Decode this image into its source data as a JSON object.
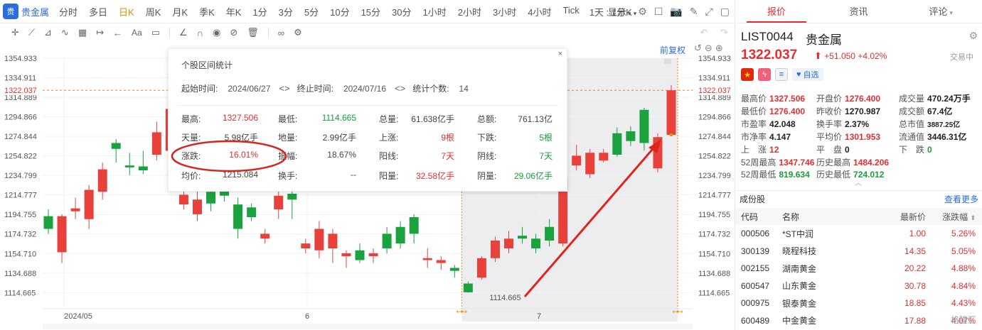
{
  "toolbar": {
    "logo_text": "贵",
    "stock_name": "贵金属",
    "periods": [
      "分时",
      "多日",
      "日K",
      "周K",
      "月K",
      "季K",
      "年K",
      "1分",
      "3分",
      "5分",
      "10分",
      "15分",
      "30分",
      "1小时",
      "2小时",
      "3小时",
      "4小时",
      "Tick"
    ],
    "active_period": "日K",
    "combo": "1天 : 1分K",
    "display_label": "显示",
    "display_chev": "▾"
  },
  "chart": {
    "fuquan_label": "前复权",
    "y_ticks": [
      "1354.933",
      "1334.911",
      "1314.889",
      "1294.866",
      "1274.844",
      "1254.822",
      "1234.799",
      "1214.777",
      "1194.755",
      "1174.732",
      "1154.710",
      "1134.688",
      "1114.665"
    ],
    "right_ticks": [
      "1354.933",
      "1334.911",
      "1314.889",
      "1294.866",
      "1274.844",
      "1254.822",
      "1234.799",
      "1214.777",
      "1194.755",
      "1174.732",
      "1154.710",
      "1134.688",
      "1114.665"
    ],
    "current_price_tag": "1322.037",
    "x_labels": [
      "2024/05",
      "6",
      "7"
    ],
    "low_label": "1114.665",
    "colors": {
      "up": "#e8413c",
      "down": "#1aa23e",
      "accent": "#f08a00",
      "selection": "#e9e9ec"
    }
  },
  "chart_data": {
    "type": "candlestick",
    "title": "",
    "ylim": [
      1104,
      1368
    ],
    "current_price": 1322.037,
    "selection_low": 1114.665,
    "x_ticks": [
      "2024/05",
      "6",
      "7"
    ],
    "candles": [
      {
        "o": 1193,
        "c": 1180,
        "h": 1200,
        "l": 1175
      },
      {
        "o": 1156,
        "c": 1193,
        "h": 1195,
        "l": 1145
      },
      {
        "o": 1198,
        "c": 1201,
        "h": 1212,
        "l": 1190
      },
      {
        "o": 1190,
        "c": 1220,
        "h": 1225,
        "l": 1180
      },
      {
        "o": 1218,
        "c": 1241,
        "h": 1248,
        "l": 1210
      },
      {
        "o": 1268,
        "c": 1262,
        "h": 1272,
        "l": 1248
      },
      {
        "o": 1245,
        "c": 1243,
        "h": 1258,
        "l": 1235
      },
      {
        "o": 1244,
        "c": 1240,
        "h": 1260,
        "l": 1236
      },
      {
        "o": 1256,
        "c": 1279,
        "h": 1290,
        "l": 1250
      },
      {
        "o": 1303,
        "c": 1260,
        "h": 1310,
        "l": 1255
      },
      {
        "o": 1215,
        "c": 1205,
        "h": 1222,
        "l": 1200
      },
      {
        "o": 1210,
        "c": 1195,
        "h": 1220,
        "l": 1188
      },
      {
        "o": 1206,
        "c": 1218,
        "h": 1228,
        "l": 1198
      },
      {
        "o": 1220,
        "c": 1214,
        "h": 1226,
        "l": 1208
      },
      {
        "o": 1205,
        "c": 1180,
        "h": 1212,
        "l": 1170
      },
      {
        "o": 1192,
        "c": 1202,
        "h": 1206,
        "l": 1188
      },
      {
        "o": 1170,
        "c": 1175,
        "h": 1180,
        "l": 1165
      },
      {
        "o": 1200,
        "c": 1214,
        "h": 1220,
        "l": 1190
      },
      {
        "o": 1210,
        "c": 1216,
        "h": 1226,
        "l": 1190
      },
      {
        "o": 1160,
        "c": 1165,
        "h": 1170,
        "l": 1155
      },
      {
        "o": 1180,
        "c": 1158,
        "h": 1188,
        "l": 1150
      },
      {
        "o": 1175,
        "c": 1160,
        "h": 1180,
        "l": 1145
      },
      {
        "o": 1152,
        "c": 1155,
        "h": 1158,
        "l": 1140
      },
      {
        "o": 1148,
        "c": 1158,
        "h": 1165,
        "l": 1145
      },
      {
        "o": 1155,
        "c": 1152,
        "h": 1160,
        "l": 1145
      },
      {
        "o": 1160,
        "c": 1175,
        "h": 1182,
        "l": 1155
      },
      {
        "o": 1165,
        "c": 1182,
        "h": 1188,
        "l": 1160
      },
      {
        "o": 1175,
        "c": 1192,
        "h": 1195,
        "l": 1165
      },
      {
        "o": 1150,
        "c": 1148,
        "h": 1160,
        "l": 1140
      },
      {
        "o": 1148,
        "c": 1145,
        "h": 1152,
        "l": 1138
      },
      {
        "o": 1140,
        "c": 1137,
        "h": 1143,
        "l": 1130
      },
      {
        "o": 1124,
        "c": 1115,
        "h": 1126,
        "l": 1114.665
      },
      {
        "o": 1130,
        "c": 1150,
        "h": 1152,
        "l": 1128
      },
      {
        "o": 1150,
        "c": 1168,
        "h": 1172,
        "l": 1146
      },
      {
        "o": 1160,
        "c": 1170,
        "h": 1178,
        "l": 1155
      },
      {
        "o": 1170,
        "c": 1173,
        "h": 1182,
        "l": 1165
      },
      {
        "o": 1160,
        "c": 1170,
        "h": 1175,
        "l": 1155
      },
      {
        "o": 1168,
        "c": 1182,
        "h": 1190,
        "l": 1162
      },
      {
        "o": 1165,
        "c": 1232,
        "h": 1235,
        "l": 1162
      },
      {
        "o": 1245,
        "c": 1255,
        "h": 1266,
        "l": 1240
      },
      {
        "o": 1236,
        "c": 1258,
        "h": 1262,
        "l": 1232
      },
      {
        "o": 1250,
        "c": 1258,
        "h": 1262,
        "l": 1248
      },
      {
        "o": 1256,
        "c": 1278,
        "h": 1284,
        "l": 1254
      },
      {
        "o": 1270,
        "c": 1280,
        "h": 1285,
        "l": 1265
      },
      {
        "o": 1302,
        "c": 1268,
        "h": 1304,
        "l": 1260
      },
      {
        "o": 1274,
        "c": 1242,
        "h": 1278,
        "l": 1238
      },
      {
        "o": 1322.037,
        "c": 1276.4,
        "h": 1327.506,
        "l": 1276.4
      }
    ],
    "candle_colors": [
      "down",
      "up",
      "up",
      "up",
      "up",
      "down",
      "down",
      "down",
      "up",
      "up",
      "up",
      "up",
      "down",
      "down",
      "down",
      "down",
      "up",
      "up",
      "down",
      "up",
      "up",
      "up",
      "up",
      "down",
      "up",
      "down",
      "down",
      "down",
      "up",
      "up",
      "down",
      "down",
      "up",
      "up",
      "up",
      "down",
      "down",
      "down",
      "up",
      "up",
      "up",
      "up",
      "down",
      "down",
      "down",
      "up",
      "up"
    ]
  },
  "stat": {
    "title": "个股区间统计",
    "close_icon": "×",
    "start_label": "起始时间:",
    "start_value": "2024/06/27",
    "end_label": "终止时间:",
    "end_value": "2024/07/16",
    "count_label": "统计个数:",
    "count_value": "14",
    "rows": [
      [
        {
          "l": "最高:",
          "v": "1327.506",
          "c": "red"
        },
        {
          "l": "最低:",
          "v": "1114.665",
          "c": "green"
        },
        {
          "l": "总量:",
          "v": "61.638亿手",
          "c": "gray"
        },
        {
          "l": "总额:",
          "v": "761.13亿",
          "c": "gray"
        }
      ],
      [
        {
          "l": "天量:",
          "v": "5.98亿手",
          "c": "gray"
        },
        {
          "l": "地量:",
          "v": "2.99亿手",
          "c": "gray"
        },
        {
          "l": "上涨:",
          "v": "9根",
          "c": "red"
        },
        {
          "l": "下跌:",
          "v": "5根",
          "c": "green"
        }
      ],
      [
        {
          "l": "涨跌:",
          "v": "16.01%",
          "c": "red"
        },
        {
          "l": "振幅:",
          "v": "18.67%",
          "c": "gray"
        },
        {
          "l": "阳线:",
          "v": "7天",
          "c": "red"
        },
        {
          "l": "阴线:",
          "v": "7天",
          "c": "green"
        }
      ],
      [
        {
          "l": "均价:",
          "v": "1215.084",
          "c": "gray"
        },
        {
          "l": "换手:",
          "v": "--",
          "c": "gray"
        },
        {
          "l": "阳量:",
          "v": "32.58亿手",
          "c": "red"
        },
        {
          "l": "阴量:",
          "v": "29.06亿手",
          "c": "green"
        }
      ]
    ]
  },
  "panel": {
    "tabs": [
      "报价",
      "资讯",
      "评论"
    ],
    "code": "LIST0044",
    "name": "贵金属",
    "price": "1322.037",
    "arrow": "⬆",
    "change": "+51.050",
    "change_pct": "+4.02%",
    "state": "交易中",
    "fav_label": "自选",
    "quotes": [
      [
        {
          "l": "最高价",
          "v": "1327.506",
          "c": "red"
        },
        {
          "l": "开盘价",
          "v": "1276.400",
          "c": "red"
        },
        {
          "l": "成交量",
          "v": "470.24万手",
          "c": "dark"
        }
      ],
      [
        {
          "l": "最低价",
          "v": "1276.400",
          "c": "red"
        },
        {
          "l": "昨收价",
          "v": "1270.987",
          "c": "dark"
        },
        {
          "l": "成交额",
          "v": "67.4亿",
          "c": "dark"
        }
      ],
      [
        {
          "l": "市盈率",
          "v": "42.048",
          "c": "dark"
        },
        {
          "l": "换手率",
          "v": "2.37%",
          "c": "dark"
        },
        {
          "l": "总市值",
          "v": "3887.25亿",
          "c": "dark"
        }
      ],
      [
        {
          "l": "市净率",
          "v": "4.147",
          "c": "dark"
        },
        {
          "l": "平均价",
          "v": "1301.953",
          "c": "red"
        },
        {
          "l": "流通值",
          "v": "3446.31亿",
          "c": "dark"
        }
      ],
      [
        {
          "l": "上　涨",
          "v": "12",
          "c": "red"
        },
        {
          "l": "平　盘",
          "v": "0",
          "c": "dark"
        },
        {
          "l": "下　跌",
          "v": "0",
          "c": "green"
        }
      ]
    ],
    "w52": [
      [
        {
          "l": "52周最高",
          "v": "1347.746",
          "c": "red"
        },
        {
          "l": "历史最高",
          "v": "1484.206",
          "c": "red"
        }
      ],
      [
        {
          "l": "52周最低",
          "v": "819.634",
          "c": "green"
        },
        {
          "l": "历史最低",
          "v": "724.012",
          "c": "green"
        }
      ]
    ],
    "components": {
      "title": "成份股",
      "more": "查看更多",
      "headers": [
        "代码",
        "名称",
        "最新价",
        "涨跌幅"
      ],
      "rows": [
        [
          "000506",
          "*ST中润",
          "1.00",
          "5.26%"
        ],
        [
          "300139",
          "晓程科技",
          "14.35",
          "5.05%"
        ],
        [
          "002155",
          "湖南黄金",
          "20.22",
          "4.88%"
        ],
        [
          "600547",
          "山东黄金",
          "30.78",
          "4.84%"
        ],
        [
          "000975",
          "银泰黄金",
          "18.85",
          "4.43%"
        ],
        [
          "600489",
          "中金黄金",
          "17.88",
          "4.07%"
        ]
      ]
    },
    "watermark": "格隆汇"
  }
}
